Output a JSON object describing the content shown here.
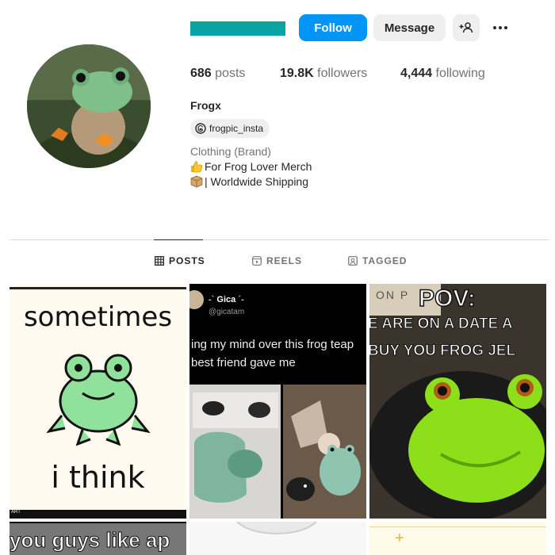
{
  "profile": {
    "username_redacted_color": "#0aa3a3",
    "follow_label": "Follow",
    "message_label": "Message",
    "add_user_icon": "add-user-icon",
    "more_icon": "more-options-icon",
    "stats": {
      "posts_count": "686",
      "posts_label": "posts",
      "followers_count": "19.8K",
      "followers_label": "followers",
      "following_count": "4,444",
      "following_label": "following"
    },
    "full_name": "Frogx",
    "threads_handle": "frogpic_insta",
    "category": "Clothing (Brand)",
    "bio_line1": "For Frog Lover Merch",
    "bio_line2": "| Worldwide Shipping"
  },
  "tabs": [
    {
      "label": "POSTS",
      "icon": "grid-icon",
      "active": true
    },
    {
      "label": "REELS",
      "icon": "reels-icon",
      "active": false
    },
    {
      "label": "TAGGED",
      "icon": "tagged-icon",
      "active": false
    }
  ],
  "posts": {
    "p1": {
      "top_text": "sometimes",
      "bottom_text": "i think",
      "corner": "ART"
    },
    "p2": {
      "user_name": "Gica",
      "user_handle": "@gicatam",
      "caption_line1": "ing my mind over this frog teap",
      "caption_line2": "best friend gave me"
    },
    "p3": {
      "title": "POV:",
      "line1": "E ARE ON A DATE A",
      "line2": "BUY YOU FROG JEL",
      "sign_text": "ON P"
    },
    "p4": {
      "text": "you guys like ap"
    },
    "p6": {
      "text": "+"
    }
  },
  "colors": {
    "accent": "#0095f6",
    "frog_green": "#8fe19b",
    "jelly_green": "#8ddf1a"
  }
}
